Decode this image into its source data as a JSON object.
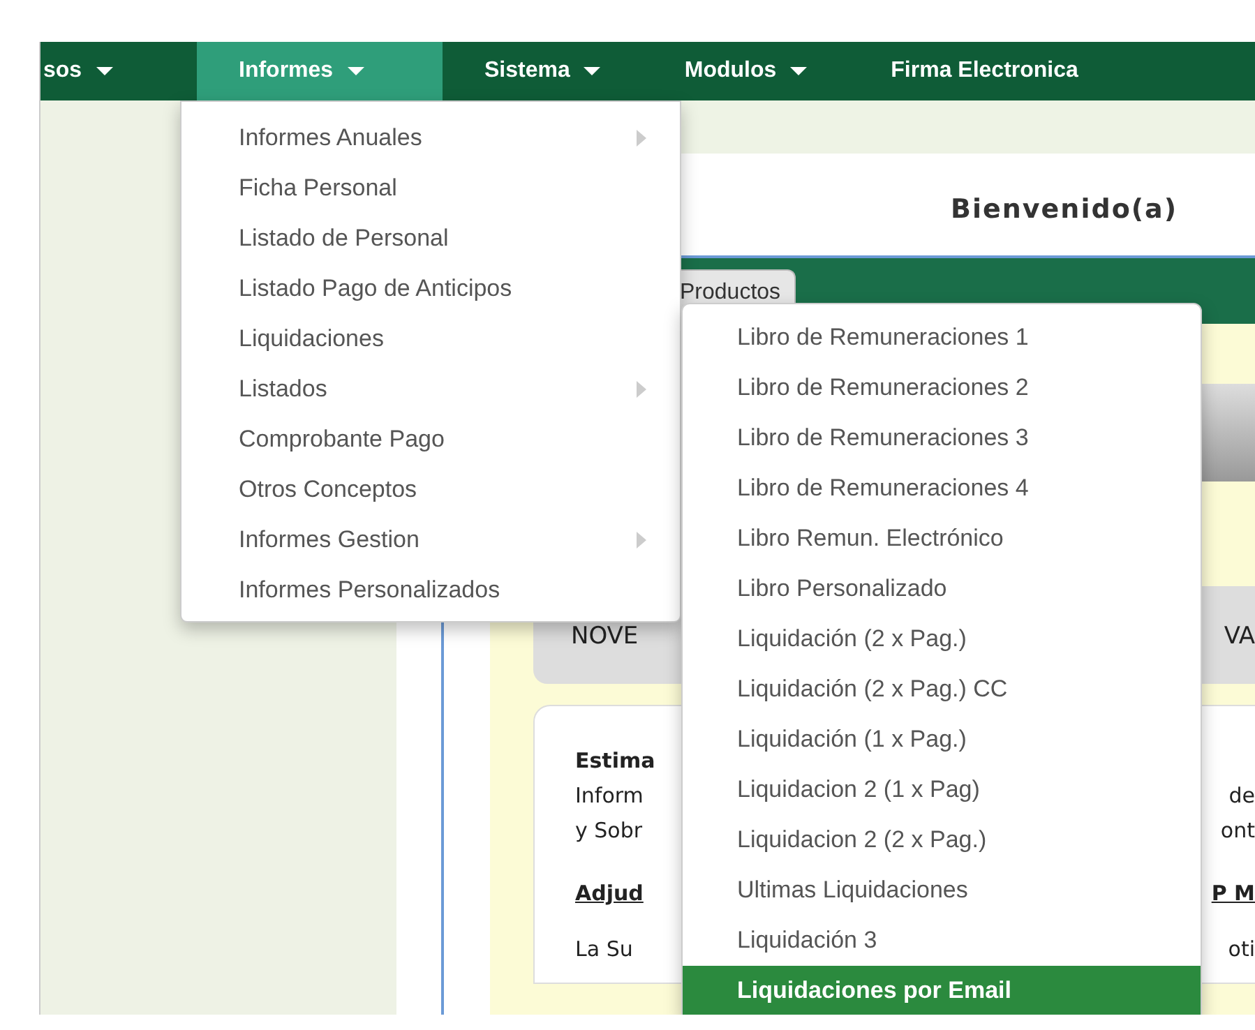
{
  "navbar": {
    "items": [
      {
        "label": "sos",
        "selected": false
      },
      {
        "label": "Informes",
        "selected": true
      },
      {
        "label": "Sistema",
        "selected": false
      },
      {
        "label": "Modulos",
        "selected": false
      },
      {
        "label": "Firma Electronica",
        "selected": false
      }
    ]
  },
  "informes_menu": {
    "items": [
      {
        "label": "Informes Anuales",
        "submenu": true
      },
      {
        "label": "Ficha Personal",
        "submenu": false
      },
      {
        "label": "Listado de Personal",
        "submenu": false
      },
      {
        "label": "Listado Pago de Anticipos",
        "submenu": false
      },
      {
        "label": "Liquidaciones",
        "submenu": false
      },
      {
        "label": "Listados",
        "submenu": true
      },
      {
        "label": "Comprobante Pago",
        "submenu": false
      },
      {
        "label": "Otros Conceptos",
        "submenu": false
      },
      {
        "label": "Informes Gestion",
        "submenu": true
      },
      {
        "label": "Informes Personalizados",
        "submenu": false
      }
    ]
  },
  "liquidaciones_submenu": {
    "items": [
      {
        "label": "Libro de Remuneraciones 1",
        "selected": false
      },
      {
        "label": "Libro de Remuneraciones 2",
        "selected": false
      },
      {
        "label": "Libro de Remuneraciones 3",
        "selected": false
      },
      {
        "label": "Libro de Remuneraciones 4",
        "selected": false
      },
      {
        "label": "Libro Remun. Electrónico",
        "selected": false
      },
      {
        "label": "Libro Personalizado",
        "selected": false
      },
      {
        "label": "Liquidación (2 x Pag.)",
        "selected": false
      },
      {
        "label": "Liquidación (2 x Pag.) CC",
        "selected": false
      },
      {
        "label": "Liquidación (1 x Pag.)",
        "selected": false
      },
      {
        "label": "Liquidacion 2 (1 x Pag)",
        "selected": false
      },
      {
        "label": "Liquidacion 2 (2 x Pag.)",
        "selected": false
      },
      {
        "label": "Ultimas Liquidaciones",
        "selected": false
      },
      {
        "label": "Liquidación 3",
        "selected": false
      },
      {
        "label": "Liquidaciones por Email",
        "selected": true
      }
    ]
  },
  "page": {
    "welcome": "Bienvenido(a)",
    "tabs": [
      {
        "label": "Productos"
      }
    ],
    "notice": {
      "left": "NOVE",
      "right": "VA"
    },
    "message_lines": [
      {
        "kind": "heading",
        "left": "Estima"
      },
      {
        "kind": "text",
        "left": "Inform",
        "right": "de"
      },
      {
        "kind": "text",
        "left": "y Sobr",
        "right": "ont"
      },
      {
        "kind": "link",
        "left": "Adjud",
        "right": "P M"
      },
      {
        "kind": "text",
        "left": "La Su",
        "right": "oti"
      }
    ]
  }
}
